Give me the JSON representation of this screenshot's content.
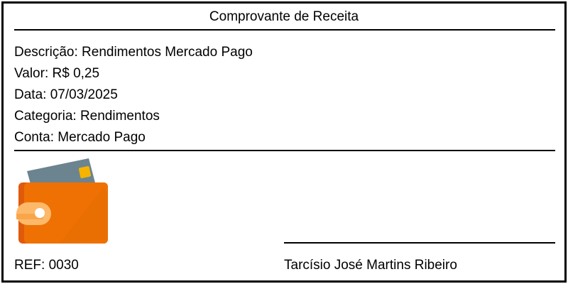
{
  "receipt": {
    "title": "Comprovante de Receita",
    "details": {
      "description_label": "Descrição:",
      "description_value": "Rendimentos Mercado Pago",
      "value_label": "Valor:",
      "value_value": "R$ 0,25",
      "date_label": "Data:",
      "date_value": "07/03/2025",
      "category_label": "Categoria:",
      "category_value": "Rendimentos",
      "account_label": "Conta:",
      "account_value": "Mercado Pago"
    },
    "illustration": {
      "icon": "wallet-icon",
      "colors": {
        "wallet_body": "#ef7103",
        "wallet_back": "#e05a0c",
        "card": "#6b8490",
        "card_chip": "#f6b300",
        "clasp": "#fdb96a",
        "clasp_button": "#ffffff"
      }
    },
    "footer": {
      "ref_label": "REF:",
      "ref_value": "0030",
      "signer_name": "Tarcísio José Martins Ribeiro"
    }
  }
}
